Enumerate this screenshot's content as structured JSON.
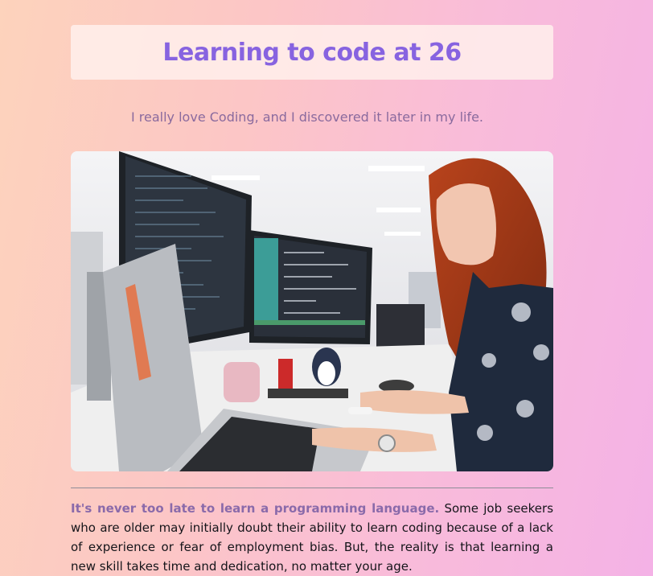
{
  "header": {
    "title": "Learning to code at 26",
    "subtitle": "I really love Coding, and I discovered it later in my life."
  },
  "hero_image": {
    "subject": "woman coding at desk with monitors and laptop"
  },
  "article": {
    "lead": "It's never too late to learn a programming language.",
    "body": " Some job seekers who are older may initially doubt their ability to learn coding because of a lack of experience or fear of employment bias. But, the reality is that learning a new skill takes time and dedication, no matter your age."
  },
  "colors": {
    "title": "#8763e0",
    "subtitle": "#8a6a9e",
    "lead": "#8a6aaa",
    "background_start": "#fdd3bc",
    "background_end": "#f4b2e6"
  }
}
